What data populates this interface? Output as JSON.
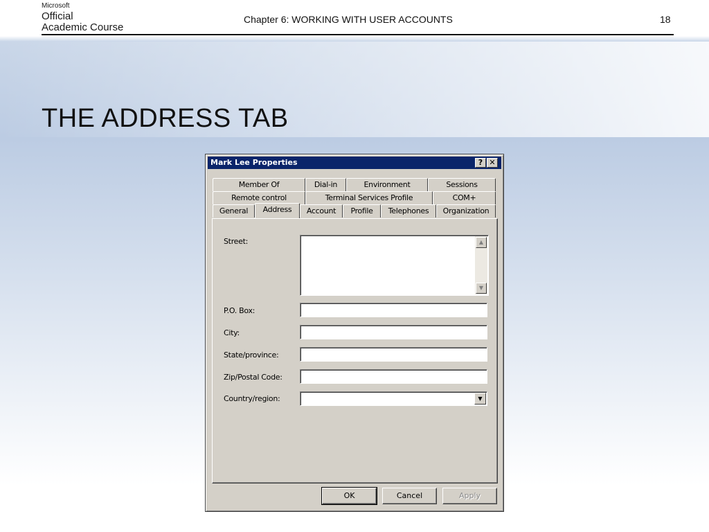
{
  "header": {
    "brand_small": "Microsoft",
    "brand_line1": "Official",
    "brand_line2": "Academic Course",
    "chapter": "Chapter 6: WORKING WITH USER ACCOUNTS",
    "page_number": "18"
  },
  "slide": {
    "title": "THE ADDRESS TAB"
  },
  "dialog": {
    "title": "Mark Lee Properties",
    "help_button": "?",
    "close_button": "✕",
    "tabs_row1": [
      "Member Of",
      "Dial-in",
      "Environment",
      "Sessions"
    ],
    "tabs_row2": [
      "Remote control",
      "Terminal Services Profile",
      "COM+"
    ],
    "tabs_row3": [
      "General",
      "Address",
      "Account",
      "Profile",
      "Telephones",
      "Organization"
    ],
    "active_tab": "Address",
    "fields": {
      "street_label": "Street:",
      "pobox_label": "P.O. Box:",
      "city_label": "City:",
      "state_label": "State/province:",
      "zip_label": "Zip/Postal Code:",
      "country_label": "Country/region:",
      "street_value": "",
      "pobox_value": "",
      "city_value": "",
      "state_value": "",
      "zip_value": "",
      "country_value": ""
    },
    "buttons": {
      "ok": "OK",
      "cancel": "Cancel",
      "apply": "Apply"
    }
  },
  "colors": {
    "titlebar": "#0a246a",
    "dialog_face": "#d4d0c8",
    "slide_band": "#bccce3"
  }
}
